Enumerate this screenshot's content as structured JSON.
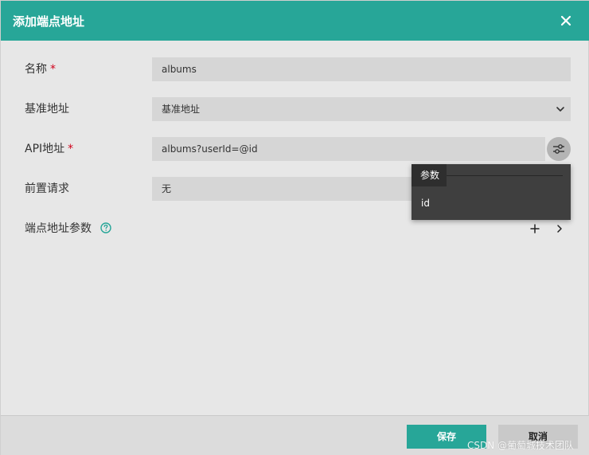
{
  "dialog": {
    "title": "添加端点地址",
    "close_icon": "close-icon"
  },
  "form": {
    "name": {
      "label": "名称",
      "required_mark": "*",
      "value": "albums"
    },
    "base_address": {
      "label": "基准地址",
      "value": "基准地址"
    },
    "api_address": {
      "label": "API地址",
      "required_mark": "*",
      "value": "albums?userId=@id"
    },
    "pre_request": {
      "label": "前置请求",
      "value": "无"
    },
    "endpoint_params": {
      "label": "端点地址参数"
    }
  },
  "param_popup": {
    "tab_label": "参数",
    "items": [
      "id"
    ]
  },
  "footer": {
    "save_label": "保存",
    "cancel_label": "取消"
  },
  "watermark": "CSDN @葡萄城技术团队",
  "colors": {
    "accent": "#27a698",
    "required": "#d0021b",
    "popup_bg": "#3f3f3f"
  }
}
